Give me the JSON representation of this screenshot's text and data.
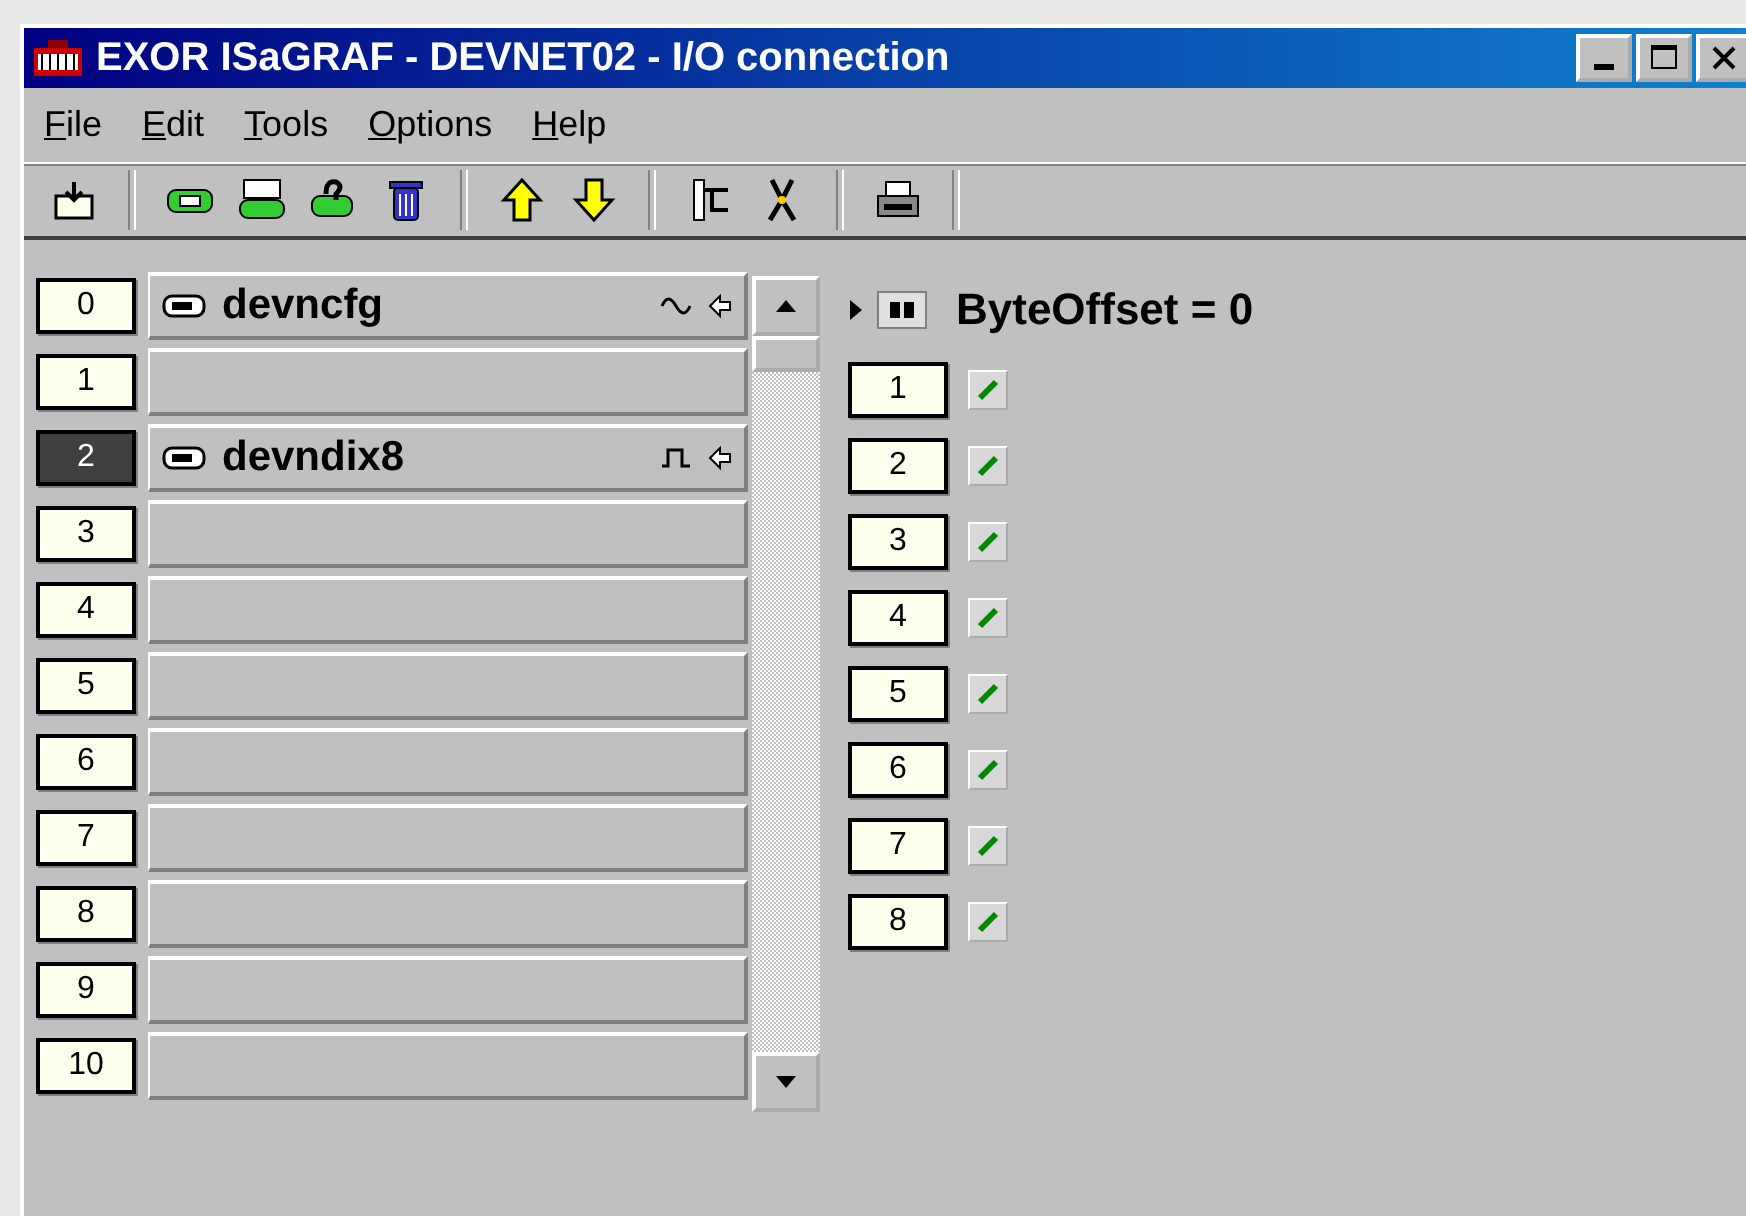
{
  "window": {
    "title": "EXOR ISaGRAF - DEVNET02 - I/O connection"
  },
  "menu": [
    {
      "label": "File"
    },
    {
      "label": "Edit"
    },
    {
      "label": "Tools"
    },
    {
      "label": "Options"
    },
    {
      "label": "Help"
    }
  ],
  "slots": [
    {
      "number": "0",
      "name": "devncfg",
      "kind": "analog",
      "selected": false
    },
    {
      "number": "1",
      "selected": false
    },
    {
      "number": "2",
      "name": "devndix8",
      "kind": "digital",
      "selected": true
    },
    {
      "number": "3",
      "selected": false
    },
    {
      "number": "4",
      "selected": false
    },
    {
      "number": "5",
      "selected": false
    },
    {
      "number": "6",
      "selected": false
    },
    {
      "number": "7",
      "selected": false
    },
    {
      "number": "8",
      "selected": false
    },
    {
      "number": "9",
      "selected": false
    },
    {
      "number": "10",
      "selected": false
    }
  ],
  "board": {
    "header": "ByteOffset = 0"
  },
  "channels": [
    "1",
    "2",
    "3",
    "4",
    "5",
    "6",
    "7",
    "8"
  ]
}
